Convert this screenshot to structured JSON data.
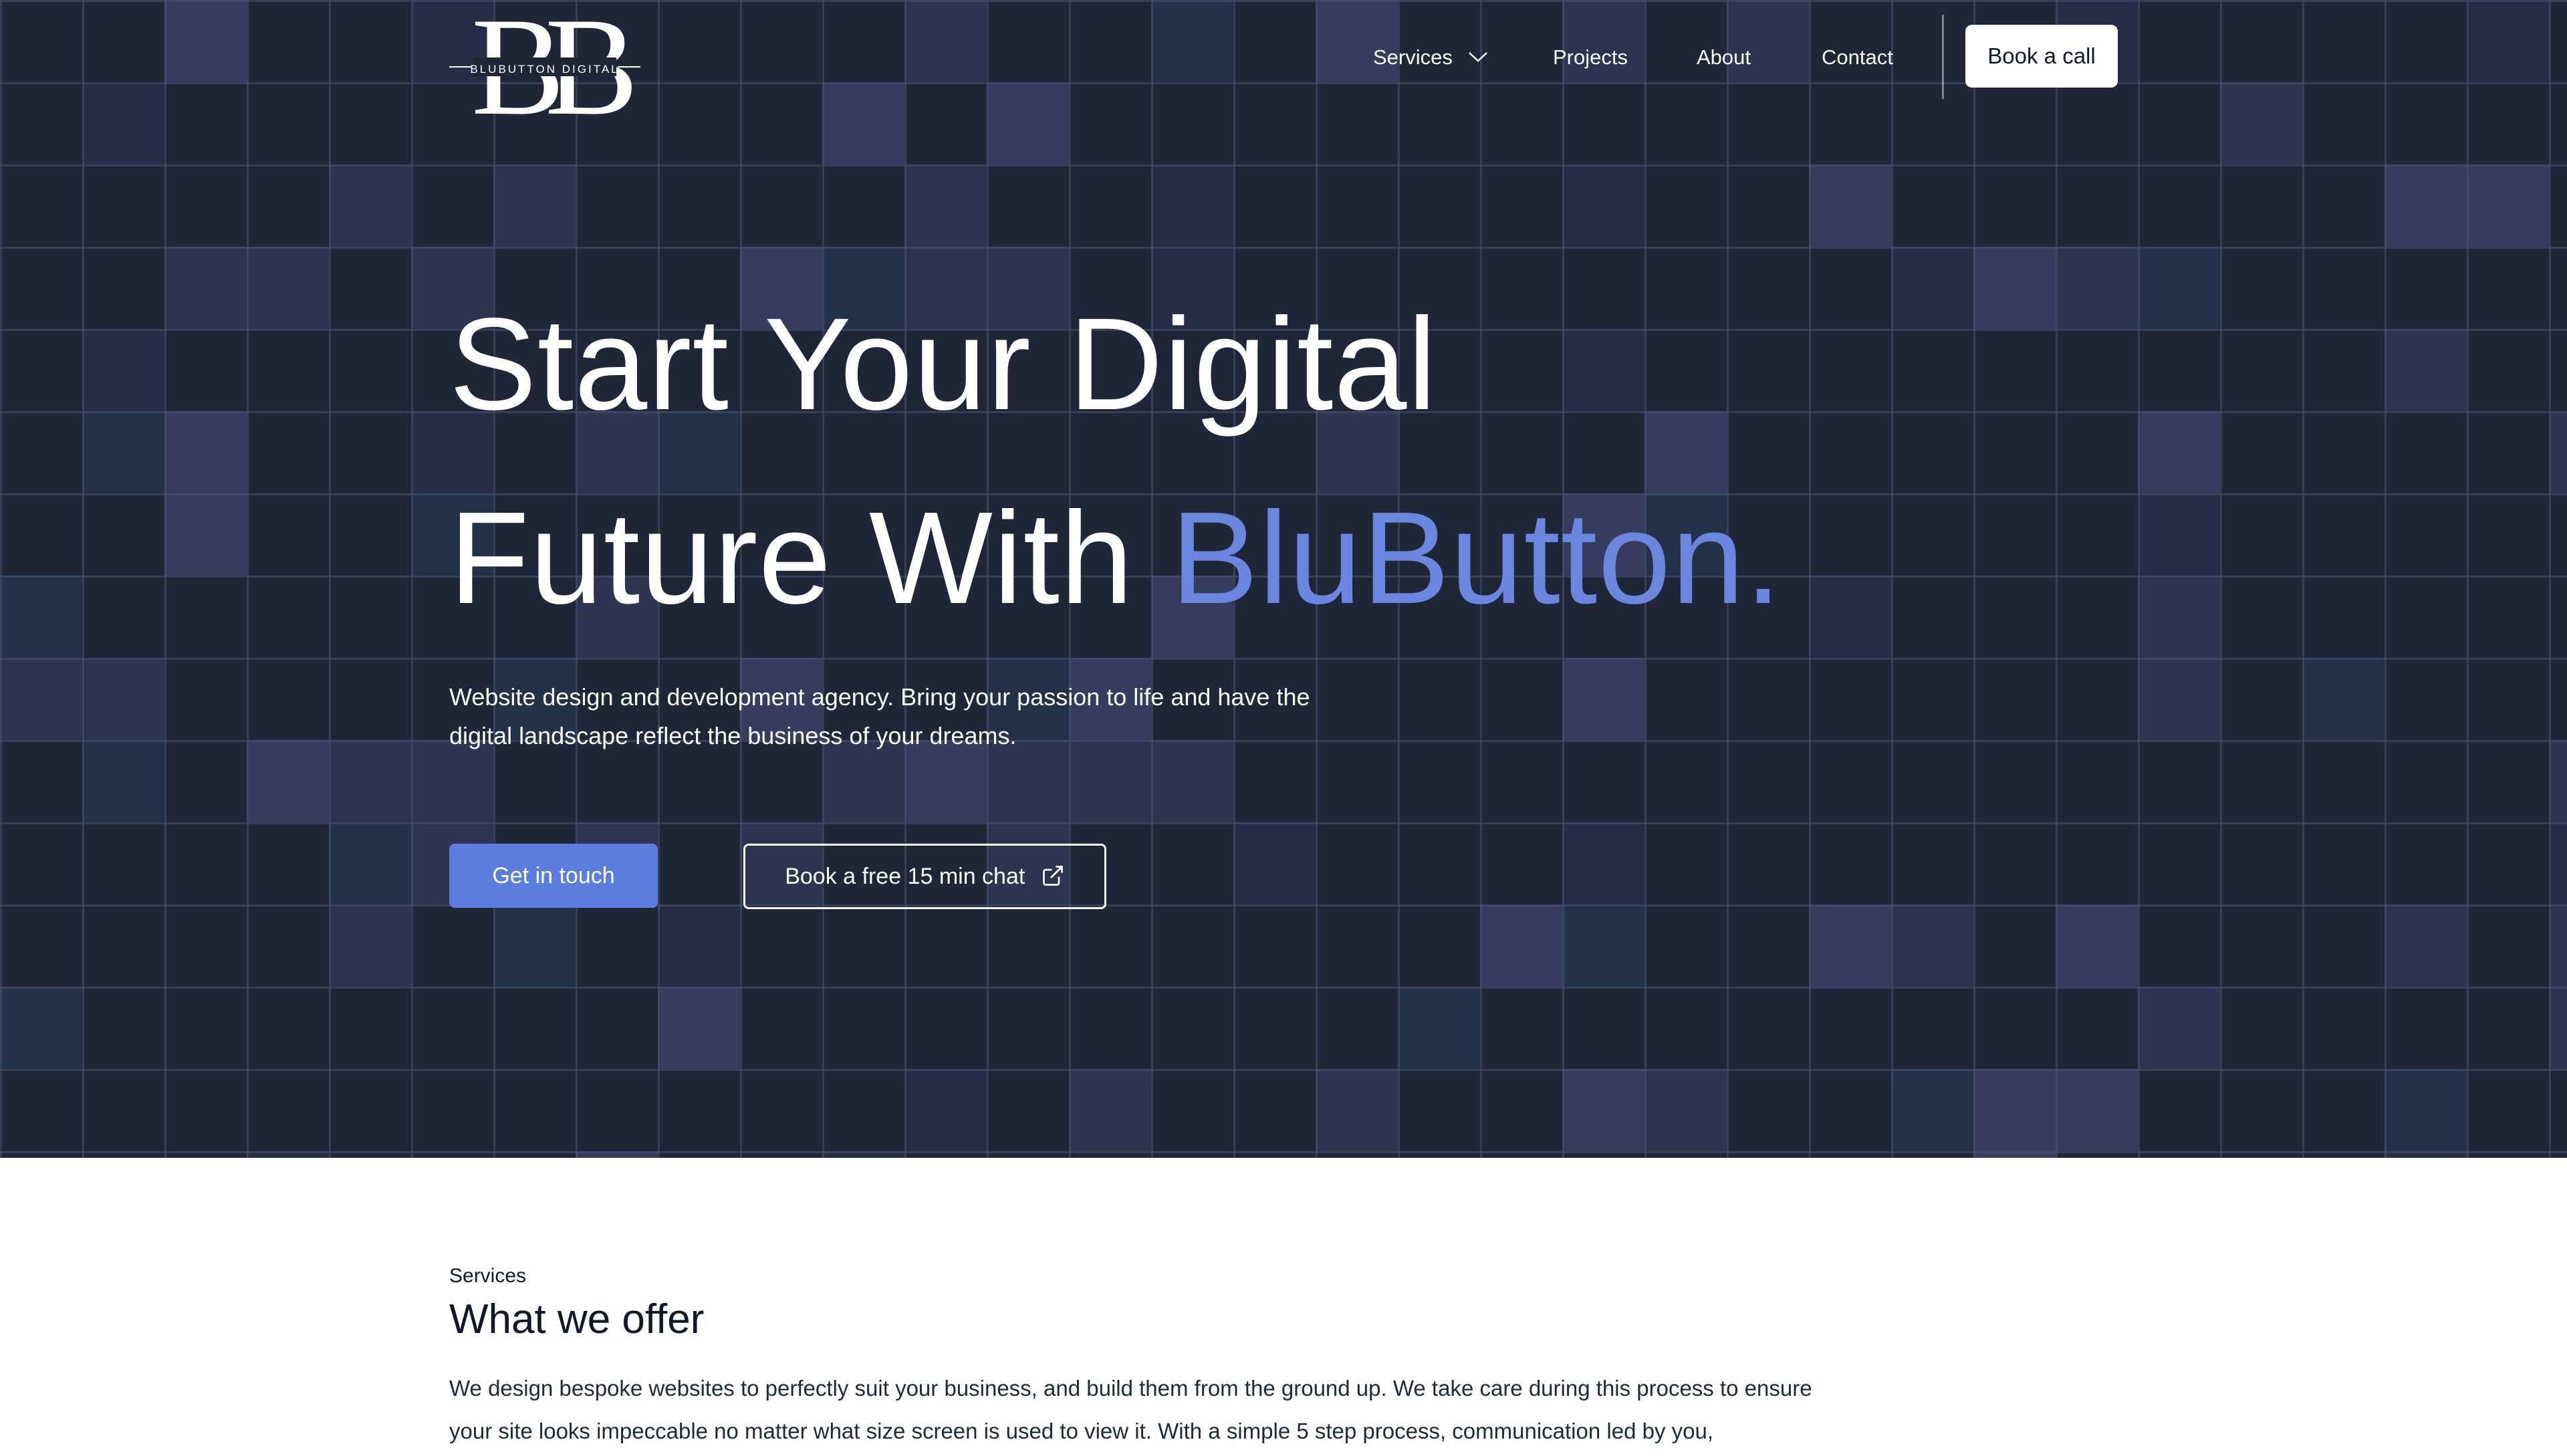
{
  "brand": {
    "logo_mark": "BB",
    "logo_text": "BLUBUTTON DIGITAL"
  },
  "nav": {
    "items": [
      {
        "label": "Services",
        "has_dropdown": true
      },
      {
        "label": "Projects"
      },
      {
        "label": "About"
      },
      {
        "label": "Contact"
      }
    ],
    "cta_label": "Book a call"
  },
  "hero": {
    "headline_line1": "Start Your Digital",
    "headline_line2_prefix": "Future With ",
    "headline_accent": "BluButton.",
    "subtext": "Website design and development agency. Bring your passion to life and have the digital landscape reflect the business of your dreams.",
    "primary_button": "Get in touch",
    "secondary_button": "Book a free 15 min chat",
    "secondary_button_icon": "external-link-icon"
  },
  "services": {
    "eyebrow": "Services",
    "title": "What we offer",
    "body": "We design bespoke websites to perfectly suit your business, and build them from the ground up. We take care during this process to ensure your site looks impeccable no matter what size screen is used to view it. With a simple 5 step process, communication led by you,"
  },
  "colors": {
    "hero_background": "#1f2638",
    "accent": "#6a86de",
    "primary_button": "#5b7ddf",
    "text_light": "#ffffff",
    "text_dark": "#111827"
  }
}
